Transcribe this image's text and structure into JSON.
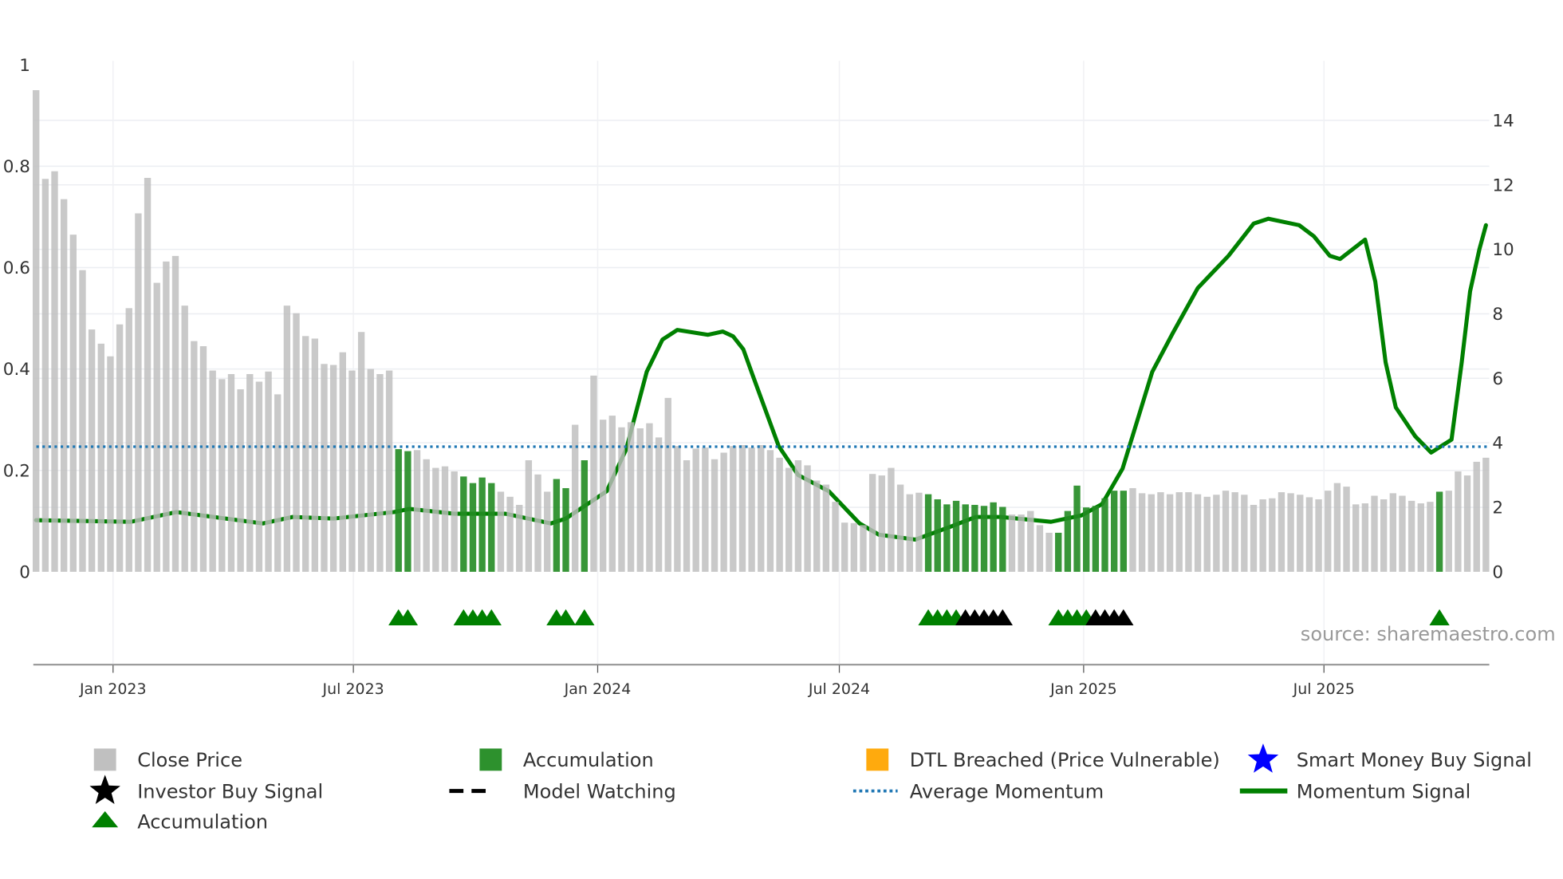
{
  "chart_data": {
    "type": "bar",
    "title": "",
    "start_date": "2022-11-04",
    "interval_days": 7,
    "left_axis": {
      "range": [
        0,
        1
      ],
      "ticks": [
        "0",
        "0.2",
        "0.4",
        "0.6",
        "0.8",
        "1"
      ],
      "tick_values": [
        0,
        0.2,
        0.4,
        0.6,
        0.8,
        1
      ]
    },
    "right_axis": {
      "range": [
        0,
        14
      ],
      "ticks": [
        "0",
        "2",
        "4",
        "6",
        "8",
        "10",
        "12",
        "14"
      ],
      "tick_values": [
        0,
        2,
        4,
        6,
        8,
        10,
        12,
        14
      ]
    },
    "x_ticks": [
      {
        "label": "Jan 2023",
        "date": "2023-01-01"
      },
      {
        "label": "Jul 2023",
        "date": "2023-07-01"
      },
      {
        "label": "Jan 2024",
        "date": "2024-01-01"
      },
      {
        "label": "Jul 2024",
        "date": "2024-07-01"
      },
      {
        "label": "Jan 2025",
        "date": "2025-01-01"
      },
      {
        "label": "Jul 2025",
        "date": "2025-07-01"
      }
    ],
    "close_price": [
      0.95,
      0.775,
      0.79,
      0.735,
      0.665,
      0.595,
      0.478,
      0.45,
      0.425,
      0.488,
      0.52,
      0.707,
      0.777,
      0.57,
      0.612,
      0.623,
      0.525,
      0.455,
      0.445,
      0.397,
      0.38,
      0.39,
      0.36,
      0.39,
      0.375,
      0.395,
      0.35,
      0.525,
      0.51,
      0.465,
      0.46,
      0.41,
      0.408,
      0.433,
      0.397,
      0.473,
      0.4,
      0.39,
      0.397,
      0.242,
      0.238,
      0.24,
      0.222,
      0.205,
      0.208,
      0.198,
      0.188,
      0.175,
      0.186,
      0.175,
      0.158,
      0.148,
      0.132,
      0.22,
      0.192,
      0.158,
      0.183,
      0.165,
      0.29,
      0.22,
      0.387,
      0.3,
      0.308,
      0.285,
      0.295,
      0.283,
      0.293,
      0.265,
      0.343,
      0.248,
      0.22,
      0.243,
      0.245,
      0.222,
      0.235,
      0.248,
      0.25,
      0.245,
      0.25,
      0.24,
      0.225,
      0.205,
      0.22,
      0.21,
      0.18,
      0.172,
      0.138,
      0.097,
      0.096,
      0.092,
      0.193,
      0.19,
      0.205,
      0.172,
      0.153,
      0.156,
      0.153,
      0.143,
      0.133,
      0.14,
      0.133,
      0.132,
      0.13,
      0.137,
      0.128,
      0.113,
      0.113,
      0.12,
      0.092,
      0.077,
      0.077,
      0.12,
      0.17,
      0.127,
      0.13,
      0.145,
      0.16,
      0.16,
      0.165,
      0.155,
      0.153,
      0.157,
      0.153,
      0.157,
      0.157,
      0.153,
      0.148,
      0.152,
      0.16,
      0.157,
      0.152,
      0.132,
      0.143,
      0.145,
      0.157,
      0.155,
      0.152,
      0.147,
      0.143,
      0.16,
      0.175,
      0.168,
      0.133,
      0.135,
      0.15,
      0.143,
      0.155,
      0.15,
      0.14,
      0.135,
      0.138,
      0.158,
      0.16,
      0.198,
      0.19,
      0.217,
      0.225
    ],
    "accumulation_weeks": [
      39,
      40,
      46,
      47,
      48,
      49,
      56,
      57,
      59,
      96,
      97,
      98,
      99,
      100,
      101,
      102,
      103,
      104,
      110,
      111,
      112,
      113,
      114,
      115,
      116,
      117,
      151
    ],
    "accumulation_markers_green": [
      39,
      40,
      46,
      47,
      48,
      49,
      56,
      57,
      59,
      96,
      97,
      98,
      99,
      110,
      111,
      112,
      113,
      151
    ],
    "accumulation_markers_black": [
      100,
      101,
      102,
      103,
      104,
      114,
      115,
      116,
      117
    ],
    "average_momentum": 3.88,
    "momentum_signal": [
      [
        0,
        1.6
      ],
      [
        10.2,
        1.55
      ],
      [
        15.1,
        1.85
      ],
      [
        24.4,
        1.5
      ],
      [
        27.6,
        1.7
      ],
      [
        32,
        1.65
      ],
      [
        38.5,
        1.85
      ],
      [
        40.2,
        1.95
      ],
      [
        45,
        1.8
      ],
      [
        50.5,
        1.8
      ],
      [
        55.4,
        1.5
      ],
      [
        57,
        1.65
      ],
      [
        61.4,
        2.5
      ],
      [
        63.5,
        3.8
      ],
      [
        65.7,
        6.2
      ],
      [
        67.4,
        7.2
      ],
      [
        69,
        7.5
      ],
      [
        72.3,
        7.35
      ],
      [
        73.9,
        7.45
      ],
      [
        75,
        7.3
      ],
      [
        76.1,
        6.9
      ],
      [
        77.1,
        6.1
      ],
      [
        79.9,
        3.9
      ],
      [
        82,
        3.0
      ],
      [
        85.3,
        2.5
      ],
      [
        88.6,
        1.5
      ],
      [
        90.7,
        1.15
      ],
      [
        94.6,
        1.0
      ],
      [
        98.4,
        1.4
      ],
      [
        101.1,
        1.7
      ],
      [
        103.8,
        1.7
      ],
      [
        109.2,
        1.55
      ],
      [
        112.5,
        1.75
      ],
      [
        114.7,
        2.1
      ],
      [
        116.9,
        3.2
      ],
      [
        120.1,
        6.2
      ],
      [
        122.3,
        7.4
      ],
      [
        125,
        8.8
      ],
      [
        128.3,
        9.8
      ],
      [
        131,
        10.8
      ],
      [
        132.6,
        10.95
      ],
      [
        135.9,
        10.75
      ],
      [
        137.5,
        10.4
      ],
      [
        139.2,
        9.8
      ],
      [
        140.3,
        9.7
      ],
      [
        143,
        10.3
      ],
      [
        144.1,
        9.0
      ],
      [
        145.2,
        6.5
      ],
      [
        146.3,
        5.1
      ],
      [
        148.4,
        4.2
      ],
      [
        150.1,
        3.7
      ],
      [
        152.3,
        4.1
      ],
      [
        153.4,
        6.5
      ],
      [
        154.3,
        8.7
      ],
      [
        155.3,
        10.0
      ],
      [
        156,
        10.75
      ]
    ],
    "colors": {
      "close": "#bdbdbd",
      "accumulation": "#228b22",
      "dtl": "#ffa500",
      "smart_money": "#0000ff",
      "investor": "#000000",
      "average": "#1f77b4",
      "momentum": "#008000"
    },
    "legend": [
      {
        "label": "Close Price",
        "symbol": "square",
        "color": "#bdbdbd"
      },
      {
        "label": "Accumulation",
        "symbol": "square",
        "color": "#228b22"
      },
      {
        "label": "DTL Breached (Price Vulnerable)",
        "symbol": "square",
        "color": "#ffa500"
      },
      {
        "label": "Smart Money Buy Signal",
        "symbol": "star",
        "color": "#0000ff"
      },
      {
        "label": "Investor Buy Signal",
        "symbol": "star",
        "color": "#000000"
      },
      {
        "label": "Model Watching",
        "symbol": "dash",
        "color": "#000000"
      },
      {
        "label": "Average Momentum",
        "symbol": "dot",
        "color": "#1f77b4"
      },
      {
        "label": "Momentum Signal",
        "symbol": "line",
        "color": "#008000"
      },
      {
        "label": "Accumulation",
        "symbol": "triangle",
        "color": "#008000"
      }
    ],
    "legend_placement": "bottom"
  },
  "source": "source: sharemaestro.com"
}
